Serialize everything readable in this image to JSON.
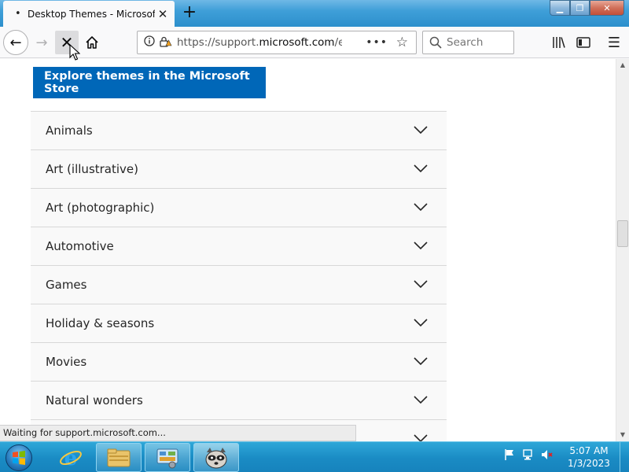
{
  "browser": {
    "tab": {
      "title": "Desktop Themes - Microsoft Support",
      "loading_indicator": "•",
      "close_glyph": "✕"
    },
    "new_tab_glyph": "+",
    "window_controls": {
      "minimize": "▁",
      "restore": "❐",
      "close": "✕"
    },
    "nav": {
      "back": "←",
      "forward": "→",
      "stop": "✕",
      "home": "⌂"
    },
    "url": {
      "prefix": "https://support.",
      "domain": "microsoft.com",
      "suffix": "/en-us/windows/desktop-themes",
      "more": "•••",
      "star": "☆"
    },
    "search": {
      "placeholder": "Search",
      "icon": "search-icon"
    },
    "toolbar": {
      "library": "|||\\",
      "sidebar": "▯",
      "menu": "☰"
    },
    "status_text": "Waiting for support.microsoft.com..."
  },
  "page": {
    "store_button_label": "Explore themes in the Microsoft Store",
    "categories": [
      "Animals",
      "Art (illustrative)",
      "Art (photographic)",
      "Automotive",
      "Games",
      "Holiday & seasons",
      "Movies",
      "Natural wonders",
      ""
    ]
  },
  "taskbar": {
    "clock_time": "5:07 AM",
    "clock_date": "1/3/2023"
  },
  "colors": {
    "accent": "#0067b8",
    "taskbar": "#1a8bc4"
  }
}
